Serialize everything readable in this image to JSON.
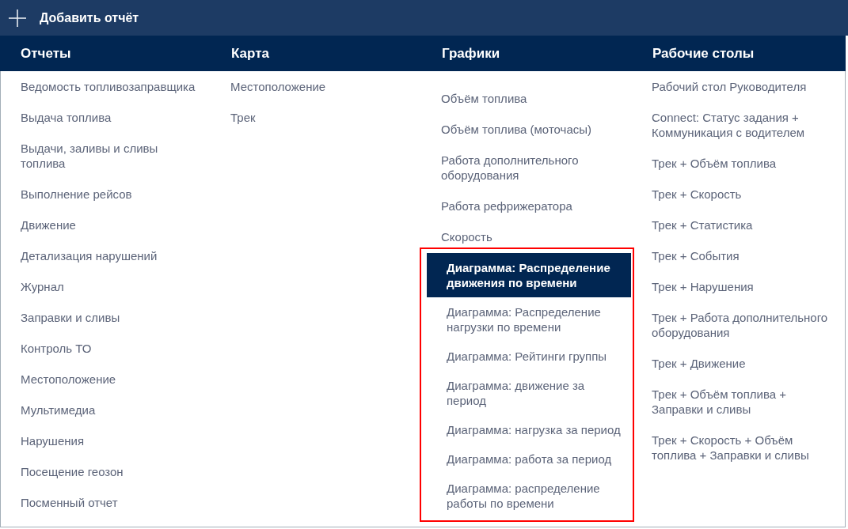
{
  "toolbar": {
    "add_button": "Добавить отчёт"
  },
  "columns": [
    {
      "title": "Отчеты",
      "items": [
        {
          "label": "Ведомость топливозаправщика",
          "selected": false
        },
        {
          "label": "Выдача топлива",
          "selected": false
        },
        {
          "label": "Выдачи, заливы и сливы\nтоплива",
          "selected": false
        },
        {
          "label": "Выполнение рейсов",
          "selected": false
        },
        {
          "label": "Движение",
          "selected": false
        },
        {
          "label": "Детализация нарушений",
          "selected": false
        },
        {
          "label": "Журнал",
          "selected": false
        },
        {
          "label": "Заправки и сливы",
          "selected": false
        },
        {
          "label": "Контроль ТО",
          "selected": false
        },
        {
          "label": "Местоположение",
          "selected": false
        },
        {
          "label": "Мультимедиа",
          "selected": false
        },
        {
          "label": "Нарушения",
          "selected": false
        },
        {
          "label": "Посещение геозон",
          "selected": false
        },
        {
          "label": "Посменный отчет",
          "selected": false
        }
      ]
    },
    {
      "title": "Карта",
      "items": [
        {
          "label": "Местоположение",
          "selected": false
        },
        {
          "label": "Трек",
          "selected": false
        }
      ]
    },
    {
      "title": "Графики",
      "items": [
        {
          "label": "Объём топлива",
          "selected": false
        },
        {
          "label": "Объём топлива (моточасы)",
          "selected": false
        },
        {
          "label": "Работа дополнительного\nоборудования",
          "selected": false
        },
        {
          "label": "Работа рефрижератора",
          "selected": false
        },
        {
          "label": "Скорость",
          "selected": false
        }
      ],
      "highlighted_items": [
        {
          "label": "Диаграмма: Распределение\nдвижения по времени",
          "selected": true
        },
        {
          "label": "Диаграмма: Распределение\nнагрузки по времени",
          "selected": false
        },
        {
          "label": "Диаграмма: Рейтинги группы",
          "selected": false
        },
        {
          "label": "Диаграмма: движение за\nпериод",
          "selected": false
        },
        {
          "label": "Диаграмма: нагрузка за период",
          "selected": false
        },
        {
          "label": "Диаграмма: работа за период",
          "selected": false
        },
        {
          "label": "Диаграмма: распределение\nработы по времени",
          "selected": false
        }
      ]
    },
    {
      "title": "Рабочие столы",
      "items": [
        {
          "label": "Рабочий стол Руководителя",
          "selected": false
        },
        {
          "label": "Connect: Статус задания +\nКоммуникация с водителем",
          "selected": false
        },
        {
          "label": "Трек + Объём топлива",
          "selected": false
        },
        {
          "label": "Трек + Скорость",
          "selected": false
        },
        {
          "label": "Трек + Статистика",
          "selected": false
        },
        {
          "label": "Трек + События",
          "selected": false
        },
        {
          "label": "Трек + Нарушения",
          "selected": false
        },
        {
          "label": "Трек + Работа дополнительного\nоборудования",
          "selected": false
        },
        {
          "label": "Трек + Движение",
          "selected": false
        },
        {
          "label": "Трек + Объём топлива +\nЗаправки и сливы",
          "selected": false
        },
        {
          "label": "Трек + Скорость + Объём\nтоплива + Заправки и сливы",
          "selected": false
        }
      ]
    }
  ]
}
